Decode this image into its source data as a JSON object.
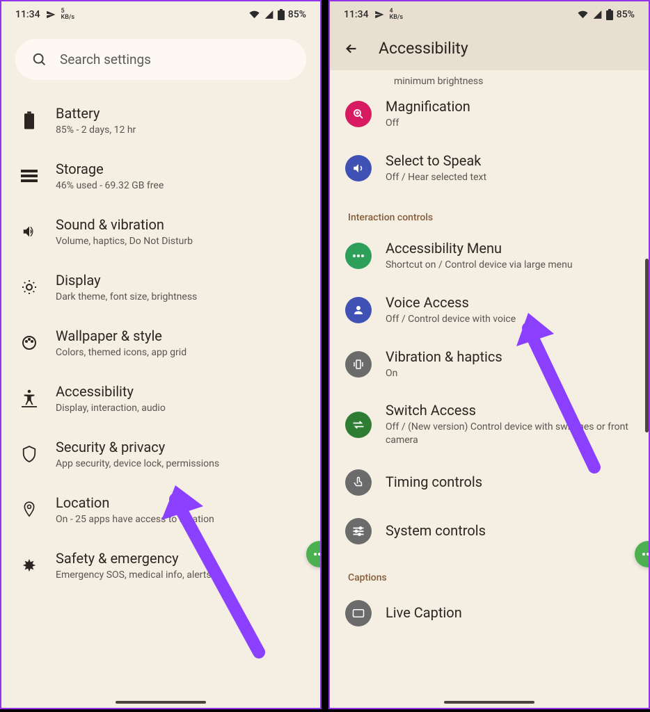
{
  "status": {
    "time": "11:34",
    "speed_val": "5",
    "speed_unit": "KB/s",
    "speed_val2": "4",
    "battery": "85%"
  },
  "search": {
    "placeholder": "Search settings"
  },
  "settings": [
    {
      "title": "Battery",
      "sub": "85% - 2 days, 12 hr"
    },
    {
      "title": "Storage",
      "sub": "46% used - 69.32 GB free"
    },
    {
      "title": "Sound & vibration",
      "sub": "Volume, haptics, Do Not Disturb"
    },
    {
      "title": "Display",
      "sub": "Dark theme, font size, brightness"
    },
    {
      "title": "Wallpaper & style",
      "sub": "Colors, themed icons, app grid"
    },
    {
      "title": "Accessibility",
      "sub": "Display, interaction, audio"
    },
    {
      "title": "Security & privacy",
      "sub": "App security, device lock, permissions"
    },
    {
      "title": "Location",
      "sub": "On - 25 apps have access to location"
    },
    {
      "title": "Safety & emergency",
      "sub": "Emergency SOS, medical info, alerts"
    }
  ],
  "accessibility": {
    "page_title": "Accessibility",
    "partial_top": "minimum brightness",
    "items_a": [
      {
        "title": "Magnification",
        "sub": "Off"
      },
      {
        "title": "Select to Speak",
        "sub": "Off / Hear selected text"
      }
    ],
    "section1": "Interaction controls",
    "items_b": [
      {
        "title": "Accessibility Menu",
        "sub": "Shortcut on / Control device via large menu"
      },
      {
        "title": "Voice Access",
        "sub": "Off / Control device with voice"
      },
      {
        "title": "Vibration & haptics",
        "sub": "On"
      },
      {
        "title": "Switch Access",
        "sub": "Off / (New version) Control device with switches or front camera"
      },
      {
        "title": "Timing controls",
        "sub": ""
      },
      {
        "title": "System controls",
        "sub": ""
      }
    ],
    "section2": "Captions",
    "items_c": [
      {
        "title": "Live Caption",
        "sub": ""
      }
    ]
  }
}
